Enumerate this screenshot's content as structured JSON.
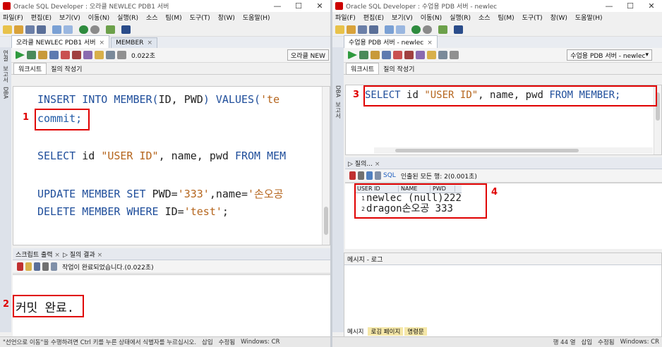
{
  "left": {
    "title": "Oracle SQL Developer : 오라클 NEWLEC PDB1 서버",
    "win_controls": [
      "—",
      "☐",
      "✕"
    ],
    "menu": [
      "파일(F)",
      "편집(E)",
      "보기(V)",
      "이동(N)",
      "실행(R)",
      "소스",
      "팀(M)",
      "도구(T)",
      "창(W)",
      "도움말(H)"
    ],
    "tabs": [
      {
        "label": "오라클 NEWLEC PDB1 서버",
        "close": "×"
      },
      {
        "label": "MEMBER",
        "close": "×"
      }
    ],
    "time": "0.022초",
    "connection": "오라클 NEW",
    "subtabs": [
      "워크시트",
      "질의 작성기"
    ],
    "side_labels": [
      "연결",
      "보고서",
      "DBA"
    ],
    "code": {
      "line1": {
        "kw": "INSERT INTO MEMBER(",
        "plain": "ID, PWD",
        "kw2": ") VALUES(",
        "str": "'te"
      },
      "line2": "commit;",
      "line3": {
        "kw": "SELECT ",
        "plain": "id ",
        "str": "\"USER ID\"",
        "plain2": ", name, pwd ",
        "kw2": "FROM MEM"
      },
      "line4": {
        "kw": "UPDATE MEMBER SET ",
        "plain": "PWD=",
        "str": "'333'",
        "plain2": ",name=",
        "str2": "'손오공"
      },
      "line5": {
        "kw": "DELETE MEMBER WHERE ",
        "plain": "ID=",
        "str": "'test'",
        "plain2": ";"
      }
    },
    "output_tabs": [
      {
        "label": "스크립트 출력",
        "close": "×"
      },
      {
        "label": "질의 결과",
        "close": "×"
      }
    ],
    "output_status": "작업이 완료되었습니다.(0.022초)",
    "output_text": "커밋 완료.",
    "markers": [
      "1",
      "2"
    ],
    "statusbar": [
      "\"선언으로 이동\"을 수행하려면 Ctrl 키를 누른 상태에서 식별자를 누르십시오.",
      "삽입",
      "수정됨",
      "Windows: CR"
    ]
  },
  "right": {
    "title": "Oracle SQL Developer : 수업용 PDB 서버 - newlec",
    "win_controls": [
      "—",
      "☐",
      "✕"
    ],
    "menu": [
      "파일(F)",
      "편집(E)",
      "보기(V)",
      "이동(N)",
      "실행(R)",
      "소스",
      "팀(M)",
      "도구(T)",
      "창(W)",
      "도움말(H)"
    ],
    "tabs": [
      {
        "label": "수업용 PDB 서버 - newlec",
        "close": "×"
      }
    ],
    "connection": "수업용 PDB 서버 - newlec",
    "subtabs": [
      "워크시트",
      "질의 작성기"
    ],
    "side_labels": [
      "DBA",
      "보고서"
    ],
    "code_line": {
      "kw": "SELECT ",
      "plain": "id ",
      "str": "\"USER ID\"",
      "plain2": ", name, pwd ",
      "kw2": "FROM MEMBER;"
    },
    "result_tab": {
      "label": "질의...",
      "close": "×"
    },
    "result_status": "인출된 모든 행: 2(0.001초)",
    "sql_label": "SQL",
    "grid": {
      "columns": [
        "USER ID",
        "NAME",
        "PWD"
      ],
      "rows": [
        {
          "n": "1",
          "user_id": "newlec",
          "name": "(null)",
          "pwd": "222"
        },
        {
          "n": "2",
          "user_id": "dragon",
          "name": "손오공",
          "pwd": "333"
        }
      ]
    },
    "msg_header": "메시지 - 로그",
    "bottom_tabs": [
      "메시지",
      "로깅 페이지",
      "명령문"
    ],
    "markers": [
      "3",
      "4"
    ],
    "statusbar": [
      "행 44 열",
      "삽입",
      "수정됨",
      "Windows: CR"
    ]
  }
}
